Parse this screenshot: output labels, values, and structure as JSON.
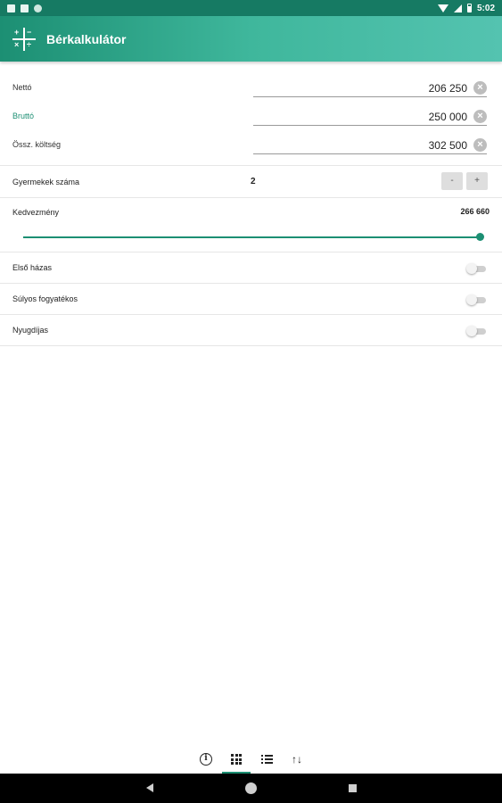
{
  "status_bar": {
    "time": "5:02"
  },
  "app_bar": {
    "title": "Bérkalkulátor",
    "icon": "calculator-icon"
  },
  "fields": [
    {
      "label": "Nettó",
      "value": "206 250",
      "active": false
    },
    {
      "label": "Bruttó",
      "value": "250 000",
      "active": true
    },
    {
      "label": "Össz. költség",
      "value": "302 500",
      "active": false
    }
  ],
  "clear_glyph": "×",
  "kids": {
    "label": "Gyermekek száma",
    "value": "2",
    "minus_label": "-",
    "plus_label": "+"
  },
  "discount": {
    "label": "Kedvezmény",
    "value": "266 660",
    "slider_fraction": 1.0
  },
  "toggles": [
    {
      "label": "Első házas",
      "on": false
    },
    {
      "label": "Súlyos fogyatékos",
      "on": false
    },
    {
      "label": "Nyugdíjas",
      "on": false
    }
  ],
  "bottom_tabs": {
    "items": [
      "info-icon",
      "grid-icon",
      "list-icon",
      "sort-icon"
    ],
    "selected": "grid-icon",
    "info_glyph": "i",
    "sort_glyph": "↑↓"
  },
  "colors": {
    "accent": "#1c8f73",
    "status_bar": "#167a63"
  }
}
